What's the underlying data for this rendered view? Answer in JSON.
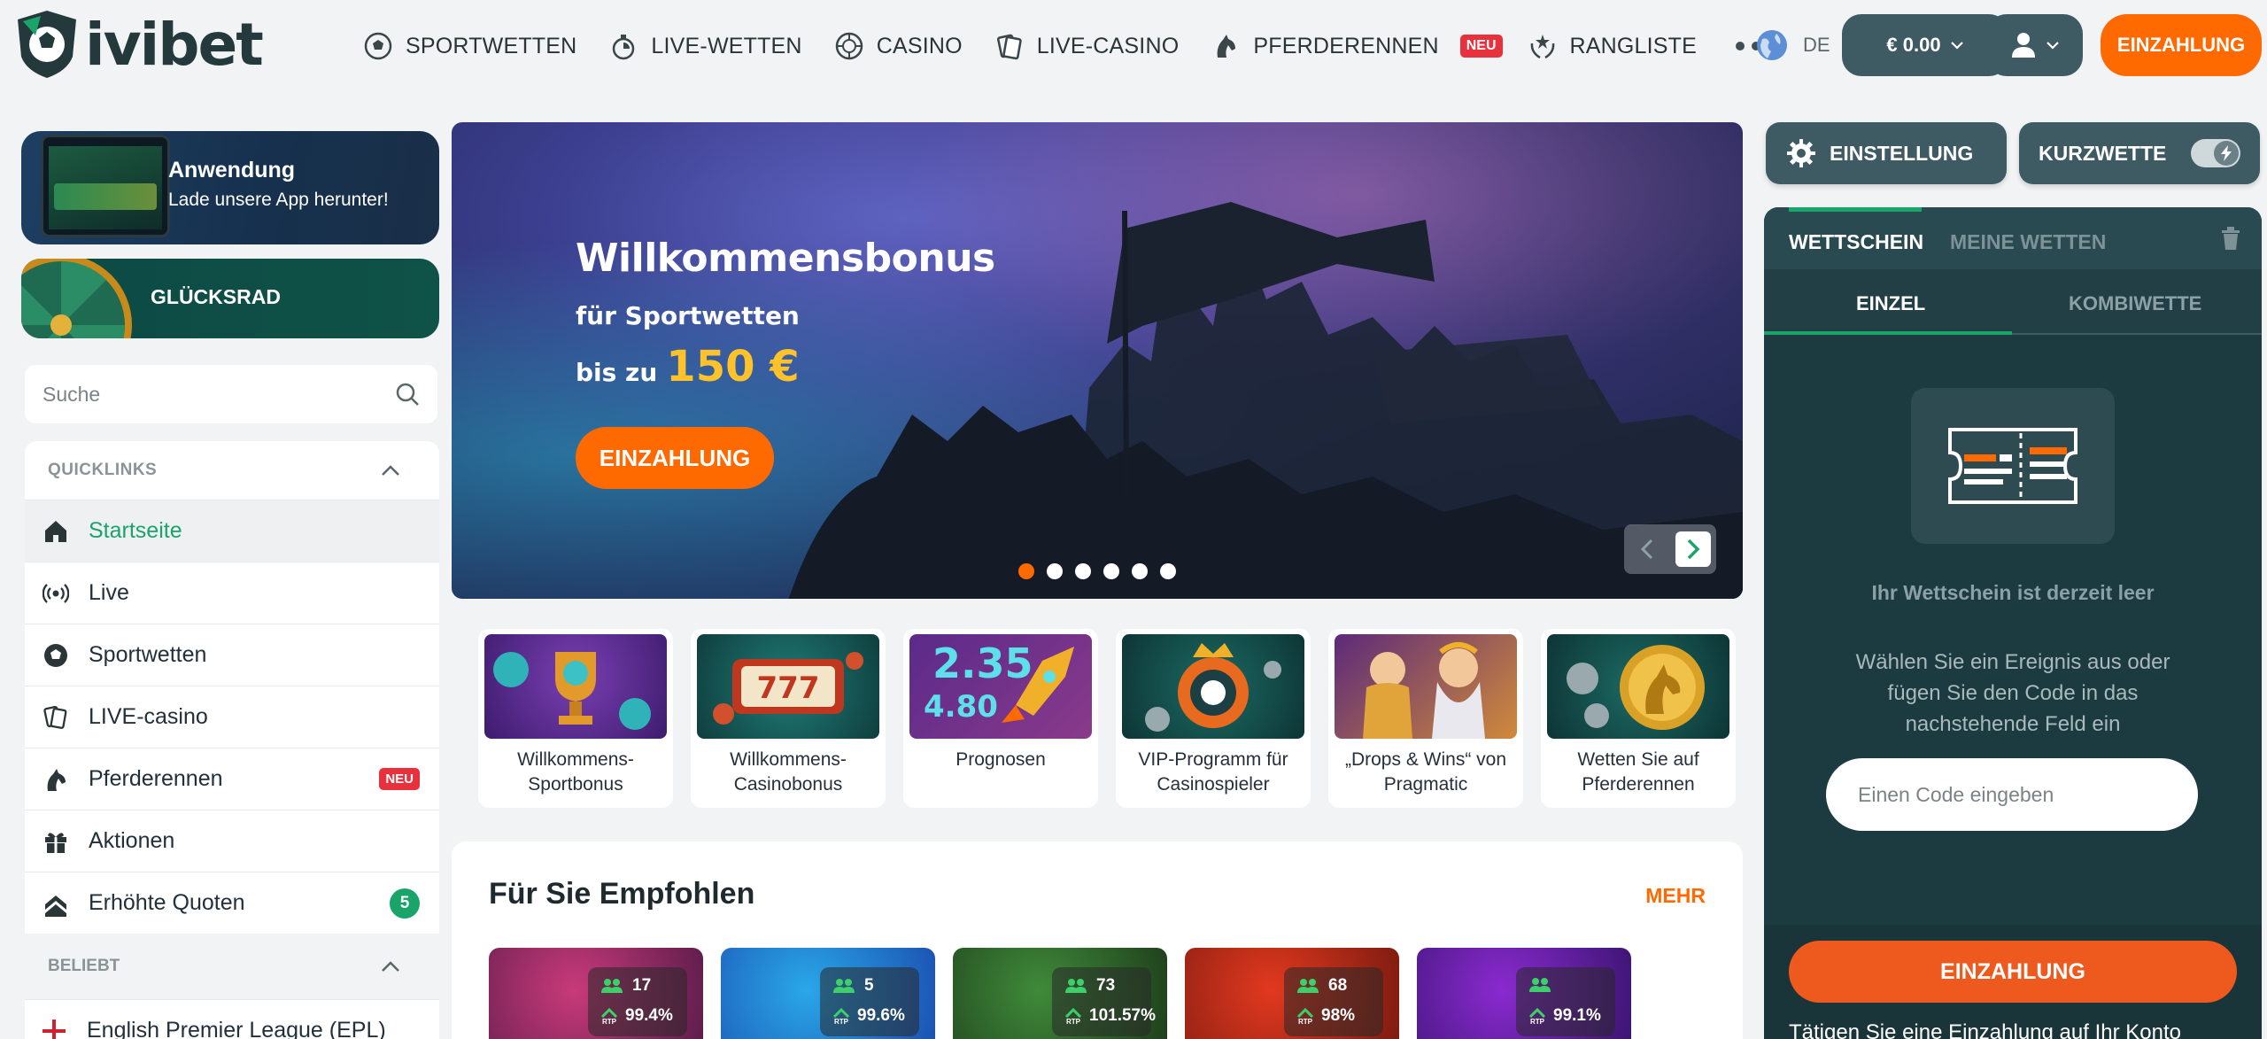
{
  "header": {
    "logo_text": "ivibet",
    "nav": [
      {
        "label": "SPORTWETTEN",
        "icon": "soccer-ball-icon"
      },
      {
        "label": "LIVE-WETTEN",
        "icon": "live-stopwatch-icon"
      },
      {
        "label": "CASINO",
        "icon": "roulette-icon"
      },
      {
        "label": "LIVE-CASINO",
        "icon": "cards-icon"
      },
      {
        "label": "PFERDERENNEN",
        "icon": "horse-icon",
        "badge": "NEU"
      },
      {
        "label": "RANGLISTE",
        "icon": "laurel-icon"
      }
    ],
    "lang": "DE",
    "balance": "€ 0.00",
    "deposit": "EINZAHLUNG"
  },
  "sidebar": {
    "app_title": "Anwendung",
    "app_sub": "Lade unsere App herunter!",
    "wheel_title": "GLÜCKSRAD",
    "search_placeholder": "Suche",
    "quicklinks_title": "QUICKLINKS",
    "items": [
      {
        "label": "Startseite",
        "icon": "home-icon",
        "active": true
      },
      {
        "label": "Live",
        "icon": "broadcast-icon"
      },
      {
        "label": "Sportwetten",
        "icon": "soccer-ball-icon"
      },
      {
        "label": "LIVE-casino",
        "icon": "cards-icon"
      },
      {
        "label": "Pferderennen",
        "icon": "horse-icon",
        "badge": "NEU"
      },
      {
        "label": "Aktionen",
        "icon": "gift-icon"
      },
      {
        "label": "Erhöhte Quoten",
        "icon": "boost-icon",
        "count": "5"
      }
    ],
    "popular_title": "BELIEBT",
    "popular_items": [
      {
        "label": "English Premier League (EPL)",
        "icon": "england-flag-icon"
      }
    ]
  },
  "hero": {
    "title": "Willkommensbonus",
    "subtitle": "für Sportwetten",
    "bonus_prefix": "bis zu",
    "bonus_amount": "150 €",
    "cta": "EINZAHLUNG",
    "slides": 6,
    "active_slide": 1
  },
  "promos": [
    {
      "label": "Willkommens-Sportbonus"
    },
    {
      "label": "Willkommens-Casinobonus"
    },
    {
      "label": "Prognosen",
      "art_text_1": "2.35",
      "art_text_2": "4.80"
    },
    {
      "label": "VIP-Programm für Casinospieler"
    },
    {
      "label": "„Drops & Wins“ von Pragmatic"
    },
    {
      "label": "Wetten Sie auf Pferderennen"
    }
  ],
  "recommended": {
    "title": "Für Sie Empfohlen",
    "more": "MEHR",
    "games": [
      {
        "players": "17",
        "rtp": "99.4%",
        "rtp_label": "RTP",
        "color1": "#c93a7a",
        "color2": "#5a1c4a"
      },
      {
        "players": "5",
        "rtp": "99.6%",
        "rtp_label": "RTP",
        "color1": "#2aa7e8",
        "color2": "#1b4fb0"
      },
      {
        "players": "73",
        "rtp": "101.57%",
        "rtp_label": "RTP",
        "color1": "#3f8a3a",
        "color2": "#1e3d1b"
      },
      {
        "players": "68",
        "rtp": "98%",
        "rtp_label": "RTP",
        "color1": "#e2391f",
        "color2": "#7a1a10"
      },
      {
        "players": "",
        "rtp": "99.1%",
        "rtp_label": "RTP",
        "color1": "#8a2ad0",
        "color2": "#3a1470"
      }
    ]
  },
  "right": {
    "settings": "EINSTELLUNG",
    "quickbet": "KURZWETTE",
    "tab_betslip": "WETTSCHEIN",
    "tab_mybets": "MEINE WETTEN",
    "sub_single": "EINZEL",
    "sub_combo": "KOMBIWETTE",
    "empty_title": "Ihr Wettschein ist derzeit leer",
    "empty_hint": "Wählen Sie ein Ereignis aus oder fügen Sie den Code in das nachstehende Feld ein",
    "code_placeholder": "Einen Code eingeben",
    "deposit": "EINZAHLUNG",
    "footer_text": "Tätigen Sie eine Einzahlung auf Ihr Konto"
  },
  "colors": {
    "accent_orange": "#ff6a00",
    "accent_green": "#1aa46a",
    "dark_slate": "#3e5a63",
    "betslip_bg": "#1c3b40",
    "badge_red": "#e7323e"
  }
}
